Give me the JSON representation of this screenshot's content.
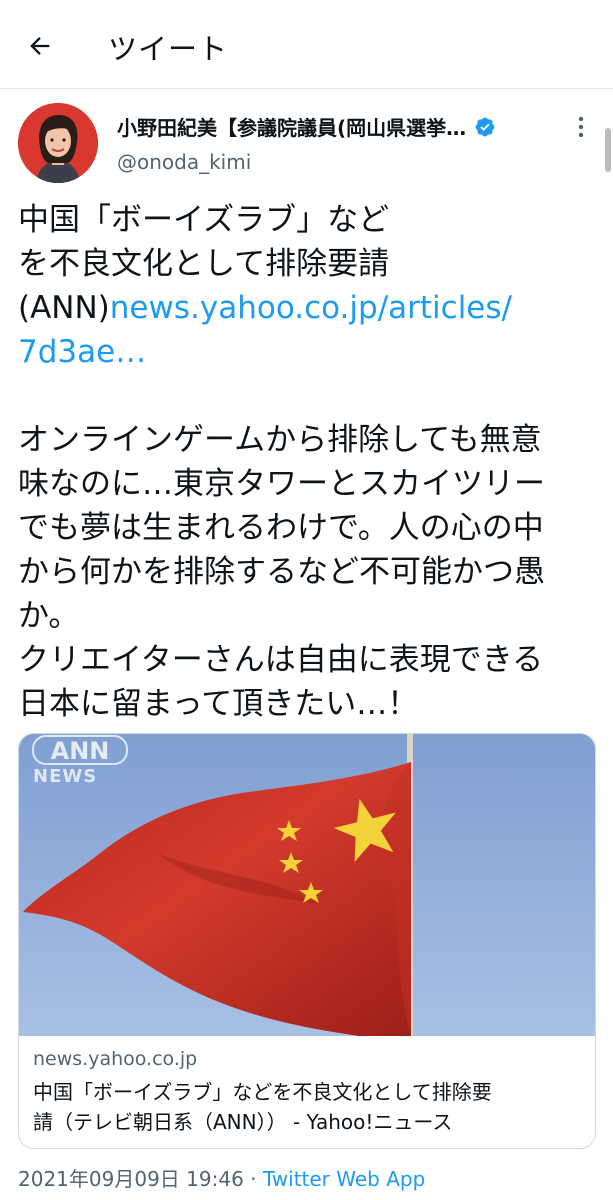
{
  "header": {
    "title": "ツイート",
    "back_icon": "arrow-left-icon"
  },
  "tweet": {
    "author": {
      "display_name": "小野田紀美【参議院議員(岡山県選挙…",
      "handle": "@onoda_kimi",
      "verified": true,
      "verified_color": "#1d9bf0"
    },
    "text_lines": [
      "中国「ボーイズラブ」など",
      "を不良文化として排除要請",
      "(ANN)"
    ],
    "link_part1": "news.yahoo.co.jp/articles/",
    "link_part2": "7d3ae…",
    "body_lines": [
      "オンラインゲームから排除しても無意",
      "味なのに…東京タワーとスカイツリー",
      "でも夢は生まれるわけで。人の心の中",
      "から何かを排除するなど不可能かつ愚",
      "か。",
      "クリエイターさんは自由に表現できる",
      "日本に留まって頂きたい…！"
    ],
    "card": {
      "image_watermark_top": "ANN",
      "image_watermark_bottom": "NEWS",
      "domain": "news.yahoo.co.jp",
      "title_line1": "中国「ボーイズラブ」などを不良文化として排除要",
      "title_line2": "請（テレビ朝日系（ANN））  - Yahoo!ニュース"
    },
    "timestamp": "2021年09月09日 19:46 · ",
    "source": "Twitter Web App"
  },
  "colors": {
    "accent": "#1d9bf0",
    "text": "#0f1419",
    "secondary": "#536471"
  }
}
